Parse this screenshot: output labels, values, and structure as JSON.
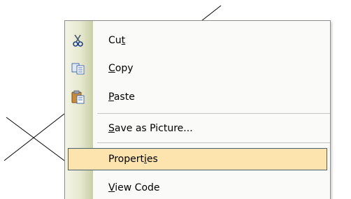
{
  "menu": {
    "items": [
      {
        "before": "Cu",
        "mnemonic": "t",
        "after": "",
        "icon": "scissors-icon"
      },
      {
        "before": "",
        "mnemonic": "C",
        "after": "opy",
        "icon": "copy-icon"
      },
      {
        "before": "",
        "mnemonic": "P",
        "after": "aste",
        "icon": "paste-icon"
      },
      {
        "before": "",
        "mnemonic": "S",
        "after": "ave as Picture...",
        "icon": ""
      },
      {
        "before": "Propert",
        "mnemonic": "i",
        "after": "es",
        "icon": ""
      },
      {
        "before": "",
        "mnemonic": "V",
        "after": "iew Code",
        "icon": ""
      }
    ],
    "highlighted_item": "Properties",
    "colors": {
      "highlight_fill": "#fde3ad",
      "highlight_border": "#4f5f6f",
      "gutter": "#e6e8cf"
    }
  }
}
